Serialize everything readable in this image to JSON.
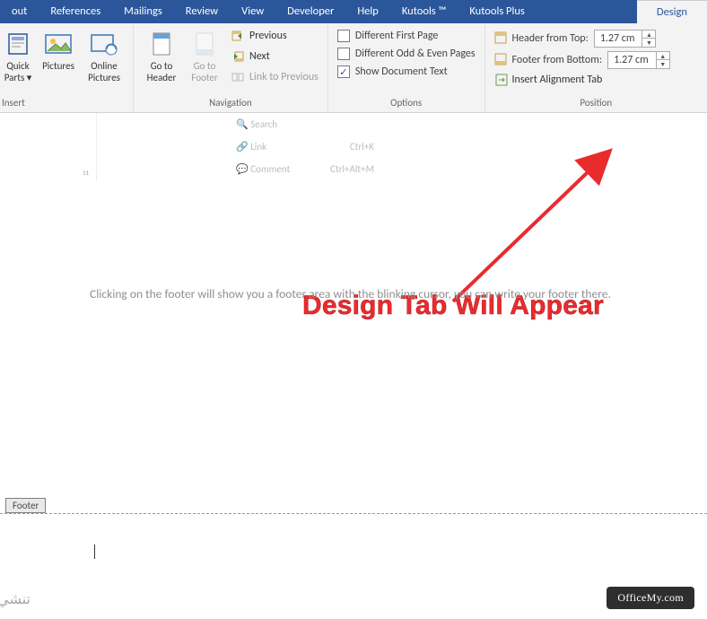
{
  "tabs": {
    "layout": "out",
    "references": "References",
    "mailings": "Mailings",
    "review": "Review",
    "view": "View",
    "developer": "Developer",
    "help": "Help",
    "kutools": "Kutools ™",
    "kutoolsplus": "Kutools Plus",
    "design": "Design"
  },
  "insert": {
    "label": "Insert",
    "quick": "Quick Parts",
    "quick1": "Quick",
    "quick2": "Parts ▾",
    "pictures": "Pictures",
    "online": "Online",
    "online2": "Pictures"
  },
  "nav": {
    "label": "Navigation",
    "gotoHeader": "Go to",
    "gotoHeader2": "Header",
    "gotoFooter": "Go to",
    "gotoFooter2": "Footer",
    "previous": "Previous",
    "next": "Next",
    "linkPrev": "Link to Previous"
  },
  "options": {
    "label": "Options",
    "diffFirst": "Different First Page",
    "diffOdd": "Different Odd & Even Pages",
    "showDoc": "Show Document Text"
  },
  "position": {
    "label": "Position",
    "headerTop": "Header from Top:",
    "footerBottom": "Footer from Bottom:",
    "insertAlign": "Insert Alignment Tab",
    "headerVal": "1.27 cm",
    "footerVal": "1.27 cm"
  },
  "fadeMenu": {
    "link": "Link",
    "linkKey": "Ctrl+K",
    "comment": "Comment",
    "commentKey": "Ctrl+Alt+M",
    "search": "Search"
  },
  "callout": "Design Tab Will Appear",
  "paragraph": "Clicking on the footer will show you a footer area with the blinking cursor, you can write your footer there.",
  "footer": {
    "tag": "Footer"
  },
  "arabic": "تنشي",
  "watermark": "OfficeMy.com"
}
